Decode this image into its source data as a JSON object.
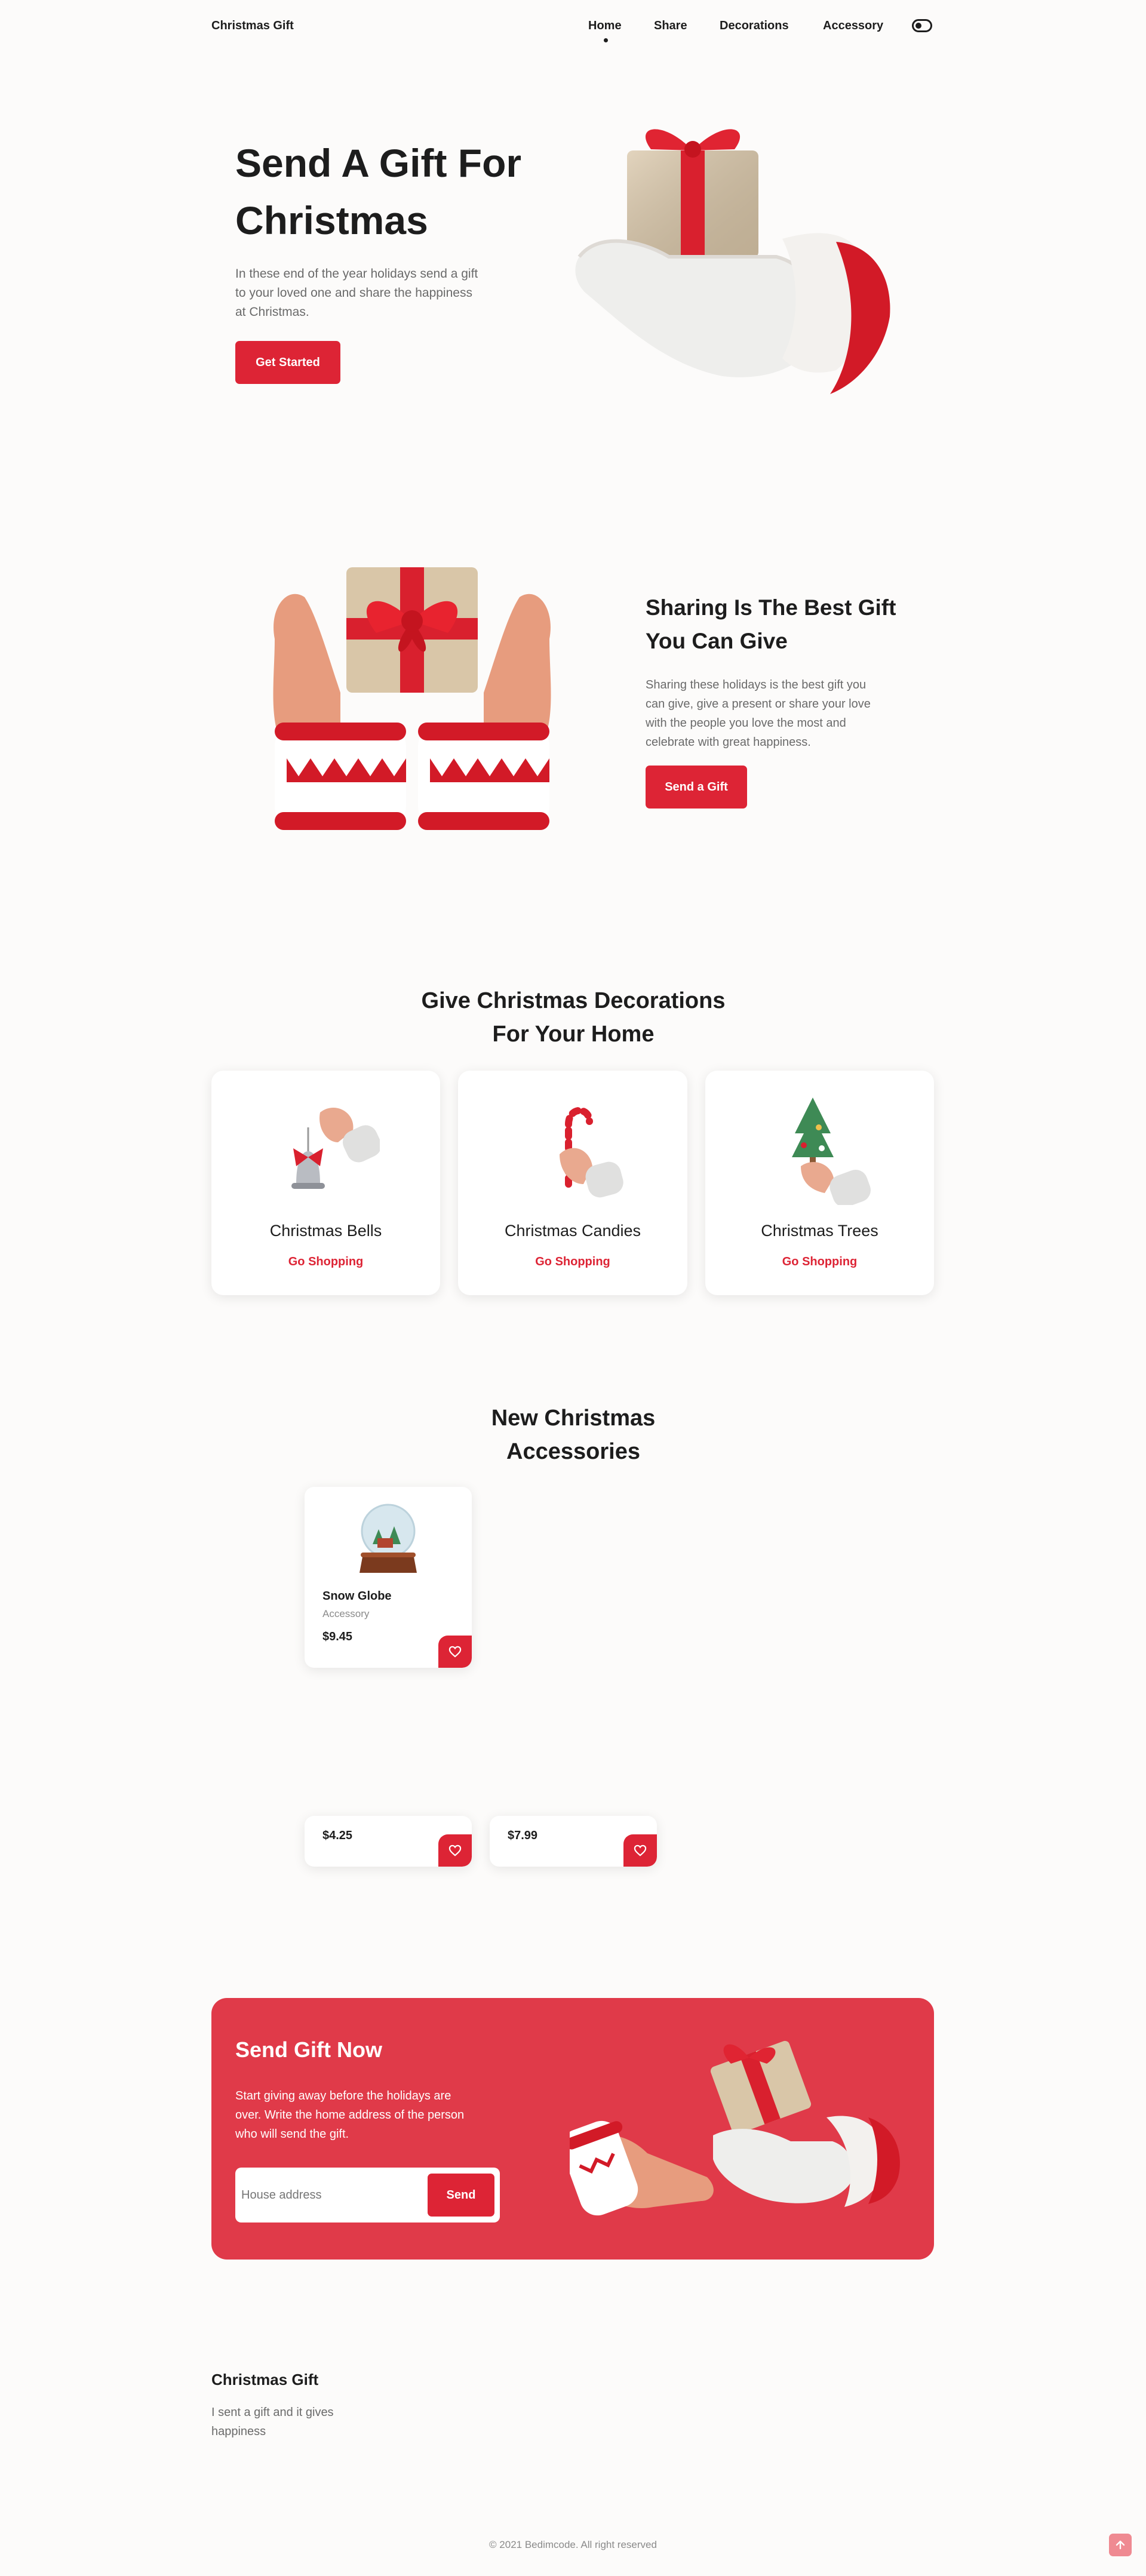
{
  "header": {
    "brand": "Christmas Gift",
    "nav": [
      {
        "label": "Home"
      },
      {
        "label": "Share"
      },
      {
        "label": "Decorations"
      },
      {
        "label": "Accessory"
      }
    ]
  },
  "hero": {
    "title_line1": "Send A Gift For",
    "title_line2": "Christmas",
    "text_lines": [
      "In these end of the year holidays send a gift",
      "to your loved one and share the happiness",
      "at Christmas."
    ],
    "button": "Get Started"
  },
  "share": {
    "title_line1": "Sharing Is The Best Gift",
    "title_line2": "You Can Give",
    "text_lines": [
      "Sharing these holidays is the best gift you",
      "can give, give a present or share your love",
      "with the people you love the most and",
      "celebrate with great happiness."
    ],
    "button": "Send a Gift"
  },
  "decorations": {
    "title_line1": "Give Christmas Decorations",
    "title_line2": "For Your Home",
    "cards": [
      {
        "title": "Christmas Bells",
        "link": "Go Shopping"
      },
      {
        "title": "Christmas Candies",
        "link": "Go Shopping"
      },
      {
        "title": "Christmas Trees",
        "link": "Go Shopping"
      }
    ]
  },
  "accessories": {
    "title_line1": "New Christmas",
    "title_line2": "Accessories",
    "items": [
      {
        "name": "Snow Globe",
        "category": "Accessory",
        "price": "$9.45"
      },
      {
        "price": "$4.25"
      },
      {
        "price": "$7.99"
      }
    ]
  },
  "cta": {
    "title": "Send Gift Now",
    "text_lines": [
      "Start giving away before the holidays are",
      "over. Write the home address of the person",
      "who will send the gift."
    ],
    "input_placeholder": "House address",
    "button": "Send"
  },
  "footer": {
    "title": "Christmas Gift",
    "text_lines": [
      "I sent a gift and it gives",
      "happiness"
    ],
    "copyright": "© 2021 Bedimcode. All right reserved"
  },
  "colors": {
    "accent": "#dd2435",
    "cta_bg": "#e03a49",
    "background": "#fcfbfa"
  },
  "icons": {
    "theme_toggle": "toggle-icon",
    "favorite": "heart-icon",
    "scroll_up": "arrow-up-icon"
  }
}
